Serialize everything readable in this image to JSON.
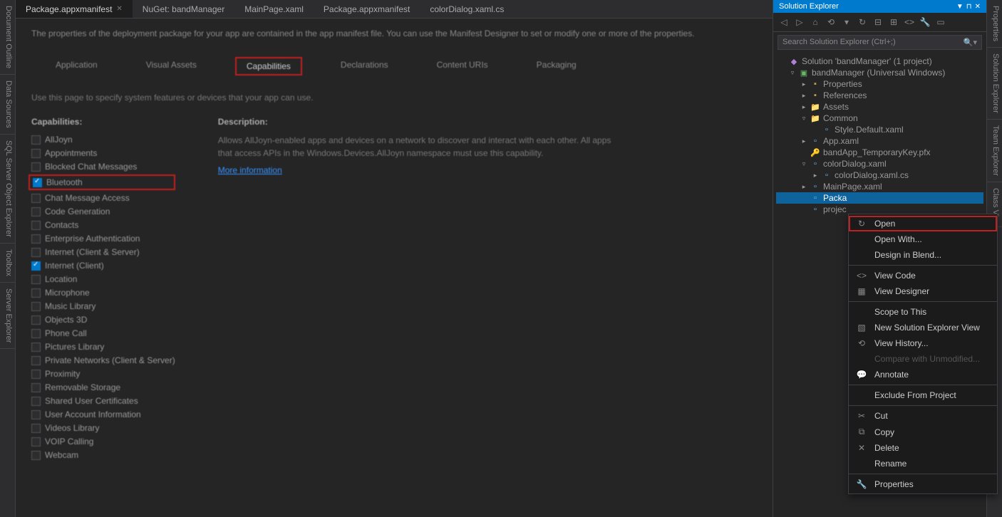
{
  "left_rail": [
    "Document Outline",
    "Data Sources",
    "SQL Server Object Explorer",
    "Toolbox",
    "Server Explorer"
  ],
  "right_rail": [
    "Properties",
    "Solution Explorer",
    "Team Explorer",
    "Class Vie"
  ],
  "doc_tabs": [
    {
      "label": "Package.appxmanifest",
      "active": true,
      "closeable": true
    },
    {
      "label": "NuGet: bandManager"
    },
    {
      "label": "MainPage.xaml"
    },
    {
      "label": "Package.appxmanifest"
    },
    {
      "label": "colorDialog.xaml.cs"
    }
  ],
  "manifest": {
    "intro": "The properties of the deployment package for your app are contained in the app manifest file. You can use the Manifest Designer to set or modify one or more of the properties.",
    "tabs": [
      "Application",
      "Visual Assets",
      "Capabilities",
      "Declarations",
      "Content URIs",
      "Packaging"
    ],
    "active_tab": "Capabilities",
    "hint": "Use this page to specify system features or devices that your app can use.",
    "caps_header": "Capabilities:",
    "desc_header": "Description:",
    "desc_text": "Allows AllJoyn-enabled apps and devices on a network to discover and interact with each other. All apps that access APIs in the Windows.Devices.AllJoyn namespace must use this capability.",
    "more_info": "More information",
    "capabilities": [
      {
        "label": "AllJoyn",
        "checked": false
      },
      {
        "label": "Appointments",
        "checked": false
      },
      {
        "label": "Blocked Chat Messages",
        "checked": false
      },
      {
        "label": "Bluetooth",
        "checked": true,
        "highlight": true
      },
      {
        "label": "Chat Message Access",
        "checked": false
      },
      {
        "label": "Code Generation",
        "checked": false
      },
      {
        "label": "Contacts",
        "checked": false
      },
      {
        "label": "Enterprise Authentication",
        "checked": false
      },
      {
        "label": "Internet (Client & Server)",
        "checked": false
      },
      {
        "label": "Internet (Client)",
        "checked": true
      },
      {
        "label": "Location",
        "checked": false
      },
      {
        "label": "Microphone",
        "checked": false
      },
      {
        "label": "Music Library",
        "checked": false
      },
      {
        "label": "Objects 3D",
        "checked": false
      },
      {
        "label": "Phone Call",
        "checked": false
      },
      {
        "label": "Pictures Library",
        "checked": false
      },
      {
        "label": "Private Networks (Client & Server)",
        "checked": false
      },
      {
        "label": "Proximity",
        "checked": false
      },
      {
        "label": "Removable Storage",
        "checked": false
      },
      {
        "label": "Shared User Certificates",
        "checked": false
      },
      {
        "label": "User Account Information",
        "checked": false
      },
      {
        "label": "Videos Library",
        "checked": false
      },
      {
        "label": "VOIP Calling",
        "checked": false
      },
      {
        "label": "Webcam",
        "checked": false
      }
    ]
  },
  "solution_explorer": {
    "title": "Solution Explorer",
    "search_placeholder": "Search Solution Explorer (Ctrl+;)",
    "toolbar_icons": [
      "back",
      "forward",
      "home",
      "sync",
      "dropdown",
      "refresh",
      "collapse",
      "show-all",
      "code",
      "properties",
      "preview"
    ],
    "tree": [
      {
        "label": "Solution 'bandManager' (1 project)",
        "indent": 0,
        "icon": "sol",
        "exp": ""
      },
      {
        "label": "bandManager (Universal Windows)",
        "indent": 1,
        "icon": "proj",
        "exp": "▿"
      },
      {
        "label": "Properties",
        "indent": 2,
        "icon": "ref",
        "exp": "▸"
      },
      {
        "label": "References",
        "indent": 2,
        "icon": "ref",
        "exp": "▸"
      },
      {
        "label": "Assets",
        "indent": 2,
        "icon": "folder",
        "exp": "▸"
      },
      {
        "label": "Common",
        "indent": 2,
        "icon": "folder",
        "exp": "▿"
      },
      {
        "label": "Style.Default.xaml",
        "indent": 3,
        "icon": "file",
        "exp": ""
      },
      {
        "label": "App.xaml",
        "indent": 2,
        "icon": "file",
        "exp": "▸"
      },
      {
        "label": "bandApp_TemporaryKey.pfx",
        "indent": 2,
        "icon": "key",
        "exp": ""
      },
      {
        "label": "colorDialog.xaml",
        "indent": 2,
        "icon": "file",
        "exp": "▿"
      },
      {
        "label": "colorDialog.xaml.cs",
        "indent": 3,
        "icon": "file",
        "exp": "▸"
      },
      {
        "label": "MainPage.xaml",
        "indent": 2,
        "icon": "file",
        "exp": "▸"
      },
      {
        "label": "Packa",
        "indent": 2,
        "icon": "file",
        "exp": "",
        "selected": true
      },
      {
        "label": "projec",
        "indent": 2,
        "icon": "file",
        "exp": ""
      }
    ]
  },
  "context_menu": [
    {
      "label": "Open",
      "icon": "↻",
      "highlight": true
    },
    {
      "label": "Open With..."
    },
    {
      "label": "Design in Blend..."
    },
    {
      "sep": true
    },
    {
      "label": "View Code",
      "icon": "<>"
    },
    {
      "label": "View Designer",
      "icon": "▦"
    },
    {
      "sep": true
    },
    {
      "label": "Scope to This"
    },
    {
      "label": "New Solution Explorer View",
      "icon": "▧"
    },
    {
      "label": "View History...",
      "icon": "⟲"
    },
    {
      "label": "Compare with Unmodified...",
      "disabled": true
    },
    {
      "label": "Annotate",
      "icon": "💬"
    },
    {
      "sep": true
    },
    {
      "label": "Exclude From Project"
    },
    {
      "sep": true
    },
    {
      "label": "Cut",
      "icon": "✂"
    },
    {
      "label": "Copy",
      "icon": "⧉"
    },
    {
      "label": "Delete",
      "icon": "✕"
    },
    {
      "label": "Rename"
    },
    {
      "sep": true
    },
    {
      "label": "Properties",
      "icon": "🔧"
    }
  ]
}
